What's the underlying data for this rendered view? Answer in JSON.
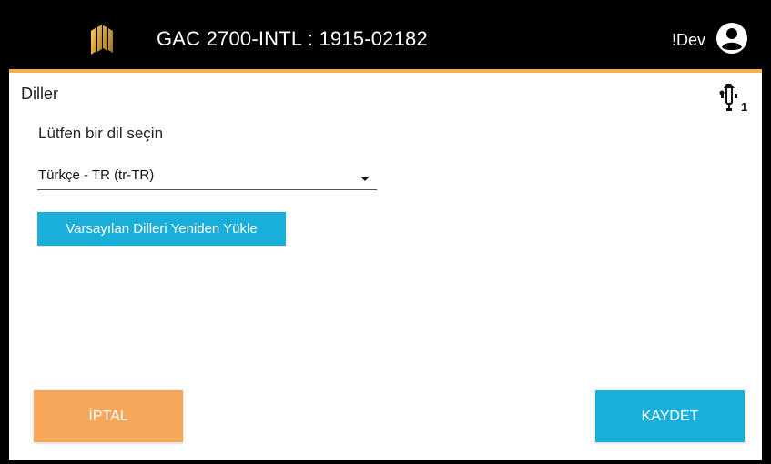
{
  "header": {
    "title": "GAC 2700-INTL : 1915-02182",
    "user": "!Dev",
    "logo_icon": "gac-logo-icon",
    "user_icon": "account-circle-icon",
    "background": "#000000",
    "accent": "#f0b34a"
  },
  "page": {
    "title": "Diller",
    "usb_icon": "usb-icon",
    "usb_count": "1"
  },
  "language": {
    "prompt": "Lütfen bir dil seçin",
    "selected": "Türkçe - TR (tr-TR)",
    "reload_button": "Varsayılan Dilleri Yeniden Yükle"
  },
  "footer": {
    "cancel_label": "İPTAL",
    "save_label": "KAYDET",
    "cancel_color": "#f5a75a",
    "save_color": "#1aaedb"
  }
}
